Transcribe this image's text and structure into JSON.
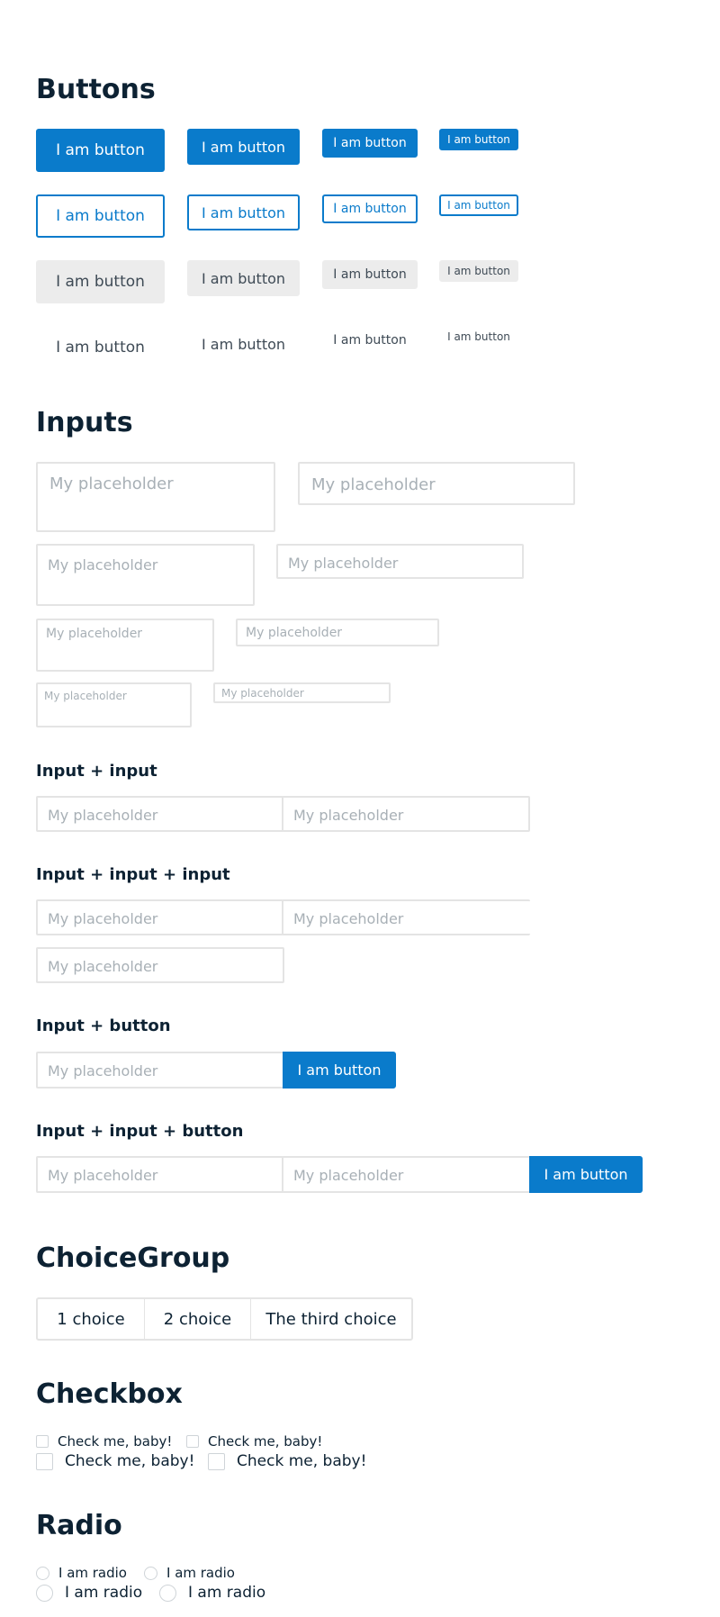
{
  "sections": {
    "buttons": "Buttons",
    "inputs": "Inputs",
    "choice_group": "ChoiceGroup",
    "checkbox": "Checkbox",
    "radio": "Radio"
  },
  "button_label": "I am button",
  "input_placeholder": "My placeholder",
  "input_groups": {
    "input_input": "Input + input",
    "input_input_input": "Input + input + input",
    "input_button": "Input + button",
    "input_input_button": "Input + input + button"
  },
  "choice_group": {
    "choices": [
      "1 choice",
      "2 choice",
      "The third choice"
    ]
  },
  "checkbox_label": "Check me, baby!",
  "radio_label": "I am radio",
  "colors": {
    "primary": "#0a7bcb",
    "ghost_bg": "#ececec",
    "border": "#e4e4e4",
    "placeholder": "#a8b0b6",
    "heading": "#0d2233"
  }
}
